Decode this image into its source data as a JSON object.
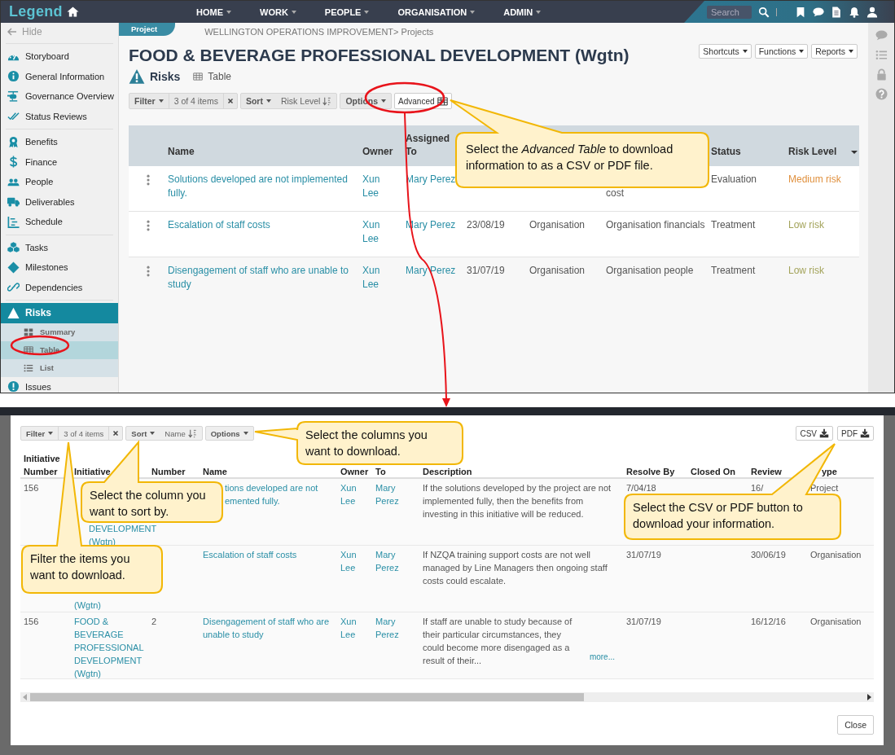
{
  "top": {
    "navbar": {
      "logo": "Legend",
      "menu": [
        "HOME",
        "WORK",
        "PEOPLE",
        "ORGANISATION",
        "ADMIN"
      ],
      "search_placeholder": "Search"
    },
    "sidebar": {
      "hide": "Hide",
      "groups": [
        {
          "items": [
            {
              "label": "Storyboard",
              "selected": false
            },
            {
              "label": "General Information",
              "selected": false
            },
            {
              "label": "Governance Overview",
              "selected": false
            },
            {
              "label": "Status Reviews",
              "selected": false
            }
          ]
        },
        {
          "items": [
            {
              "label": "Benefits",
              "selected": false
            },
            {
              "label": "Finance",
              "selected": false
            },
            {
              "label": "People",
              "selected": false
            },
            {
              "label": "Deliverables",
              "selected": false
            },
            {
              "label": "Schedule",
              "selected": false
            }
          ]
        },
        {
          "items": [
            {
              "label": "Tasks",
              "selected": false
            },
            {
              "label": "Milestones",
              "selected": false
            },
            {
              "label": "Dependencies",
              "selected": false
            }
          ]
        },
        {
          "items": [
            {
              "label": "Risks",
              "selected": true,
              "expanded": true,
              "children": [
                {
                  "label": "Summary",
                  "selected": false
                },
                {
                  "label": "Table",
                  "selected": true
                },
                {
                  "label": "List",
                  "selected": false
                }
              ]
            },
            {
              "label": "Issues",
              "selected": false
            }
          ]
        }
      ]
    },
    "project_tab": "Project",
    "breadcrumb": "WELLINGTON OPERATIONS IMPROVEMENT> Projects",
    "title": "FOOD & BEVERAGE PROFESSIONAL DEVELOPMENT (Wgtn)",
    "header_buttons": [
      "Shortcuts",
      "Functions",
      "Reports"
    ],
    "section": "Risks",
    "view": "Table",
    "toolbar": {
      "filter": "Filter",
      "filter_count": "3 of 4 items",
      "sort": "Sort",
      "sort_field": "Risk Level",
      "options": "Options",
      "advanced": "Advanced"
    },
    "table": {
      "columns": {
        "name": "Name",
        "owner": "Owner",
        "assigned_to": "Assigned To",
        "status": "Status",
        "risk_level": "Risk Level"
      },
      "rows": [
        {
          "name": "Solutions developed are not implemented fully.",
          "owner": "Xun Lee",
          "assigned_to": "Mary Perez",
          "column_7": "cost",
          "status": "Evaluation",
          "risk_level": {
            "text": "Medium risk",
            "color": "#e0913f"
          }
        },
        {
          "name": "Escalation of staff costs",
          "owner": "Xun Lee",
          "assigned_to": "Mary Perez",
          "column_5": "23/08/19",
          "column_6": "Organisation",
          "column_7": "Organisation financials",
          "status": "Treatment",
          "risk_level": {
            "text": "Low risk",
            "color": "#a3a35a"
          }
        },
        {
          "name": "Disengagement of staff who are unable to study",
          "owner": "Xun Lee",
          "assigned_to": "Mary Perez",
          "column_5": "31/07/19",
          "column_6": "Organisation",
          "column_7": "Organisation people",
          "status": "Treatment",
          "risk_level": {
            "text": "Low risk",
            "color": "#a3a35a"
          }
        }
      ]
    },
    "callout": {
      "text": "Select the *Advanced Table* to download information to as a CSV or PDF file."
    }
  },
  "modal": {
    "toolbar": {
      "filter": "Filter",
      "filter_count": "3 of 4 items",
      "sort": "Sort",
      "sort_field": "Name",
      "options": "Options"
    },
    "downloads": [
      "CSV",
      "PDF"
    ],
    "columns": [
      "Initiative Number",
      "Initiative",
      "Number",
      "Name",
      "Owner",
      "To",
      "Description",
      "Resolve By",
      "Closed On",
      "Review",
      "ype"
    ],
    "rows": [
      {
        "initiative_number": "156",
        "initiative": "DEVELOPMENT (Wgtn)",
        "name": "tions developed are not emented fully.",
        "owner": "Xun Lee",
        "assigned_to": "Mary Perez",
        "description": "If the solutions developed by the project are not implemented fully, then the benefits from investing in this initiative will be reduced.",
        "resolve_by": "7/04/18",
        "review": "16/",
        "type": "Project"
      },
      {
        "initiative": "(Wgtn)",
        "name": "Escalation of staff costs",
        "owner": "Xun Lee",
        "assigned_to": "Mary Perez",
        "description": "If NZQA training support costs are not well managed by Line Managers then ongoing staff costs could escalate.",
        "resolve_by": "31/07/19",
        "review": "30/06/19",
        "type": "Organisation"
      },
      {
        "initiative_number": "156",
        "initiative": "FOOD & BEVERAGE PROFESSIONAL DEVELOPMENT (Wgtn)",
        "number": "2",
        "name": "Disengagement of staff who are unable to study",
        "owner": "Xun Lee",
        "assigned_to": "Mary Perez",
        "description": "If staff are unable to study because of their particular circumstances, they could become more disengaged as a result of their...",
        "more_link": "more...",
        "resolve_by": "31/07/19",
        "review": "16/12/16",
        "type": "Organisation"
      }
    ],
    "callouts": [
      {
        "text": "Select the columns you want to download."
      },
      {
        "text": "Select the column you want to sort by."
      },
      {
        "text": "Select the CSV or PDF button to download your information."
      },
      {
        "text": "Filter the items you want to download."
      }
    ],
    "close": "Close"
  }
}
